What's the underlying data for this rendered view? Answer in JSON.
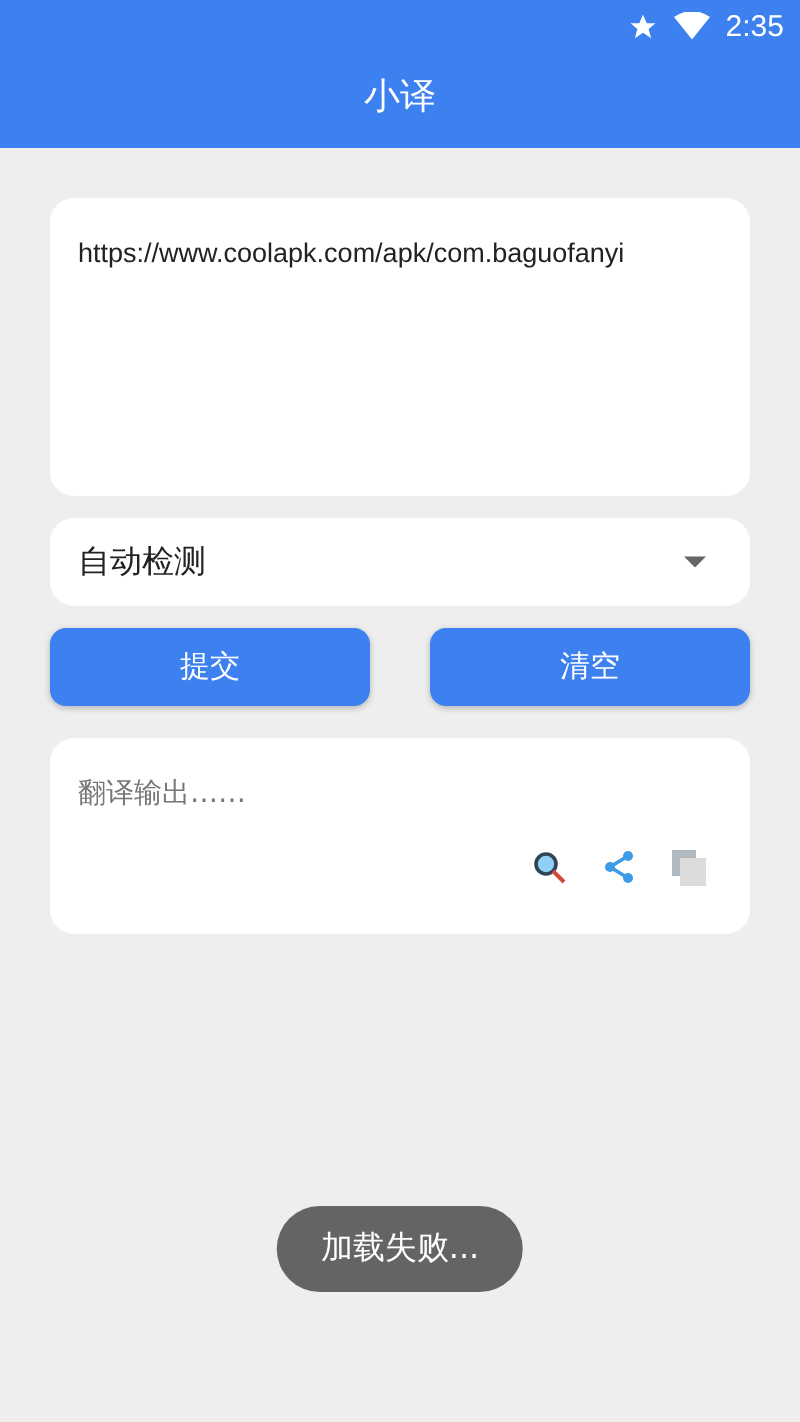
{
  "status_bar": {
    "time": "2:35"
  },
  "app_bar": {
    "title": "小译"
  },
  "input": {
    "value": "https://www.coolapk.com/apk/com.baguofanyi"
  },
  "language_select": {
    "value": "自动检测"
  },
  "buttons": [
    {
      "label": "提交"
    },
    {
      "label": "清空"
    }
  ],
  "output": {
    "placeholder": "翻译输出……"
  },
  "toast": "加载失败..."
}
